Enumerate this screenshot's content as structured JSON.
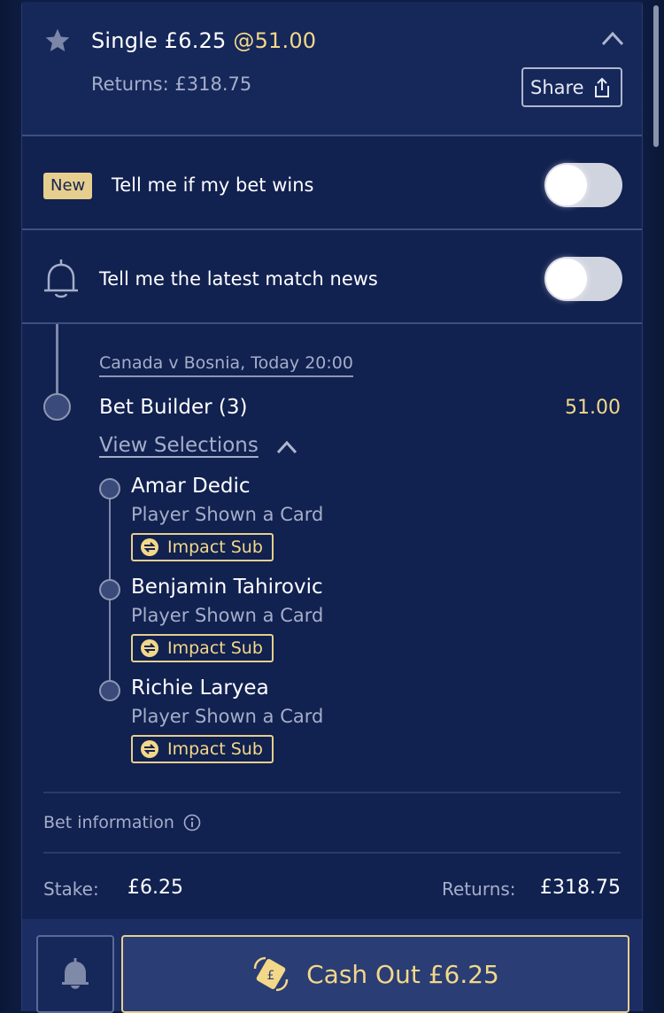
{
  "header": {
    "title_prefix": "Single £6.25",
    "title_odds": "@51.00",
    "returns_text": "Returns: £318.75",
    "share_label": "Share"
  },
  "notifications": {
    "bet_wins": {
      "badge": "New",
      "label": "Tell me if my bet wins",
      "enabled": false
    },
    "match_news": {
      "label": "Tell me the latest match news",
      "enabled": false
    }
  },
  "event": {
    "name": "Canada v Bosnia, Today 20:00",
    "market": "Bet Builder (3)",
    "odds": "51.00",
    "view_selections_label": "View Selections"
  },
  "selections": [
    {
      "player": "Amar Dedic",
      "market": "Player Shown a Card",
      "badge": "Impact Sub"
    },
    {
      "player": "Benjamin Tahirovic",
      "market": "Player Shown a Card",
      "badge": "Impact Sub"
    },
    {
      "player": "Richie Laryea",
      "market": "Player Shown a Card",
      "badge": "Impact Sub"
    }
  ],
  "bet_info": {
    "label": "Bet information",
    "stake_label": "Stake:",
    "stake_value": "£6.25",
    "returns_label": "Returns:",
    "returns_value": "£318.75"
  },
  "footer": {
    "cashout_label": "Cash Out £6.25"
  },
  "colors": {
    "background": "#0e1c42",
    "card": "#132252",
    "accent_gold": "#f3d889",
    "muted_text": "#a5aec9"
  },
  "icons": {
    "star": "star-icon",
    "collapse": "chevron-up-icon",
    "share": "share-icon",
    "bell": "bell-icon",
    "swap": "swap-icon",
    "info": "info-icon",
    "cashout": "cashout-icon"
  }
}
